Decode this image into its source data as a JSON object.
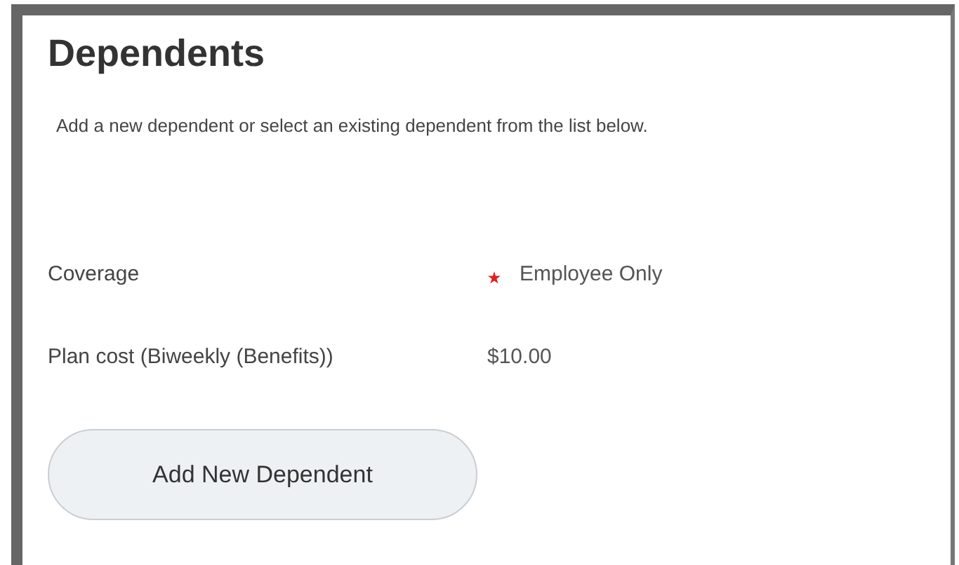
{
  "title": "Dependents",
  "description": "Add a new dependent or select an existing dependent from the list below.",
  "fields": [
    {
      "label": "Coverage",
      "value": "Employee Only",
      "required": true
    },
    {
      "label": "Plan cost (Biweekly (Benefits))",
      "value": "$10.00",
      "required": false
    }
  ],
  "button": "Add New Dependent"
}
